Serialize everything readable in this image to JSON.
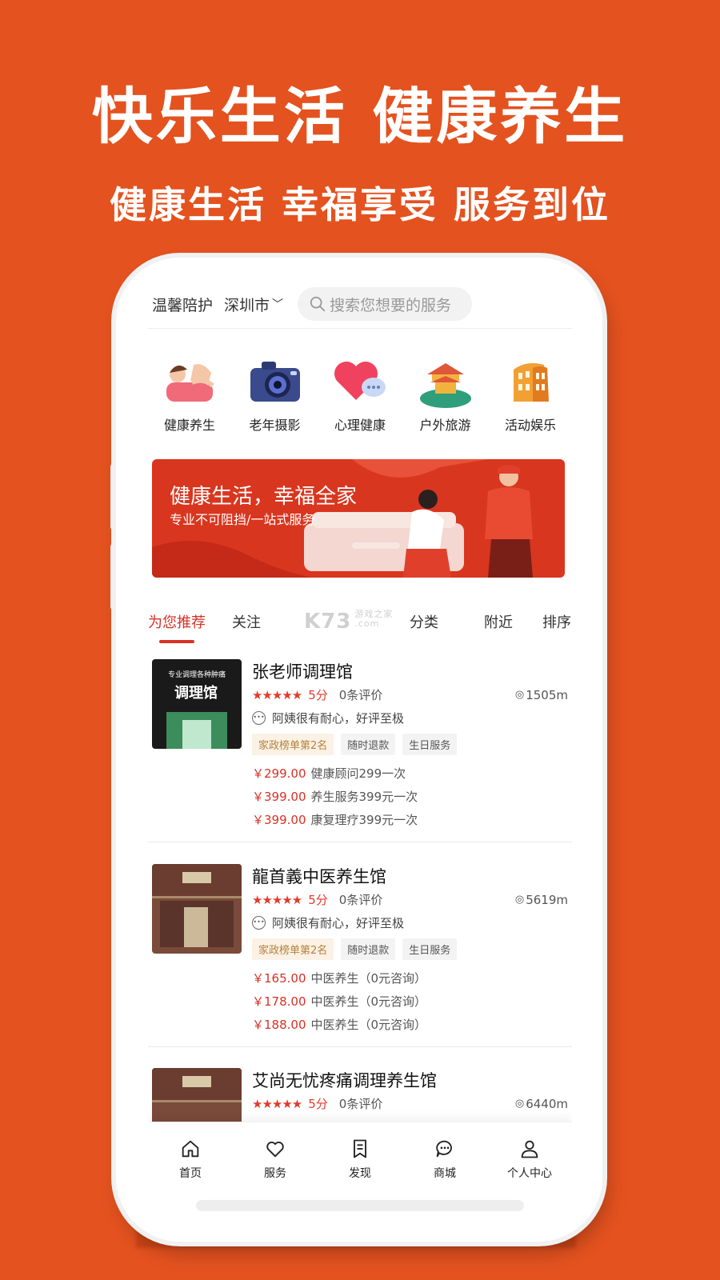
{
  "promo": {
    "headline": "快乐生活  健康养生",
    "subline": "健康生活  幸福享受  服务到位"
  },
  "header": {
    "brand": "温馨陪护",
    "city": "深圳市",
    "search_placeholder": "搜索您想要的服务"
  },
  "categories": [
    {
      "label": "健康养生",
      "icon": "massage-icon"
    },
    {
      "label": "老年摄影",
      "icon": "camera-icon"
    },
    {
      "label": "心理健康",
      "icon": "heart-chat-icon"
    },
    {
      "label": "户外旅游",
      "icon": "pavilion-icon"
    },
    {
      "label": "活动娱乐",
      "icon": "colosseum-icon"
    }
  ],
  "banner": {
    "title": "健康生活，幸福全家",
    "subtitle": "专业不可阻挡/一站式服务"
  },
  "tabs": [
    {
      "label": "为您推荐"
    },
    {
      "label": "关注"
    },
    {
      "label": "分类"
    },
    {
      "label": "附近"
    },
    {
      "label": "排序"
    }
  ],
  "watermark": {
    "brand": "K73",
    "line1": "游戏之家",
    "line2": ".com"
  },
  "shops": [
    {
      "name": "张老师调理馆",
      "stars": "★★★★★",
      "score": "5分",
      "reviews": "0条评价",
      "distance": "1505m",
      "comment": "阿姨很有耐心，好评至极",
      "tags": [
        "家政榜单第2名",
        "随时退款",
        "生日服务"
      ],
      "thumb_sign": "调理馆",
      "thumb_top": "专业调理各种肿痛",
      "prices": [
        {
          "amount": "￥299.00",
          "desc": "健康顾问299一次"
        },
        {
          "amount": "￥399.00",
          "desc": "养生服务399元一次"
        },
        {
          "amount": "￥399.00",
          "desc": "康复理疗399元一次"
        }
      ]
    },
    {
      "name": "龍首義中医养生馆",
      "stars": "★★★★★",
      "score": "5分",
      "reviews": "0条评价",
      "distance": "5619m",
      "comment": "阿姨很有耐心，好评至极",
      "tags": [
        "家政榜单第2名",
        "随时退款",
        "生日服务"
      ],
      "prices": [
        {
          "amount": "￥165.00",
          "desc": "中医养生（0元咨询）"
        },
        {
          "amount": "￥178.00",
          "desc": "中医养生（0元咨询）"
        },
        {
          "amount": "￥188.00",
          "desc": "中医养生（0元咨询）"
        }
      ]
    },
    {
      "name": "艾尚无忧疼痛调理养生馆",
      "stars": "★★★★★",
      "score": "5分",
      "reviews": "0条评价",
      "distance": "6440m"
    }
  ],
  "bottom_nav": [
    {
      "label": "首页",
      "icon": "home-icon"
    },
    {
      "label": "服务",
      "icon": "heart-icon"
    },
    {
      "label": "发现",
      "icon": "bookmark-icon"
    },
    {
      "label": "商城",
      "icon": "chat-icon"
    },
    {
      "label": "个人中心",
      "icon": "person-icon"
    }
  ],
  "colors": {
    "background": "#e4521f",
    "accent": "#d93025",
    "tag_hot_bg": "#fbf1e4",
    "tag_hot_text": "#b4823d"
  }
}
